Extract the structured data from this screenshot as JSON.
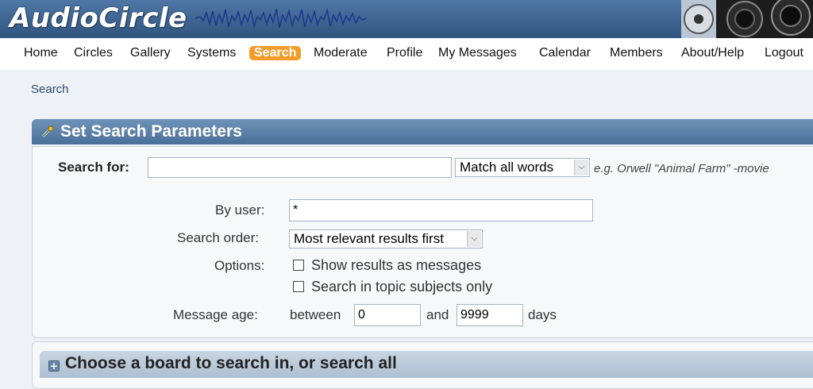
{
  "header": {
    "logo_text": "AudioCircle"
  },
  "nav": {
    "items": [
      "Home",
      "Circles",
      "Gallery",
      "Systems",
      "Search",
      "Moderate",
      "Profile",
      "My Messages",
      "Calendar",
      "Members",
      "About/Help",
      "Logout"
    ],
    "active": "Search"
  },
  "breadcrumb": "Search",
  "search_panel": {
    "title": "Set Search Parameters",
    "search_for_label": "Search for:",
    "search_for_value": "",
    "match_select": "Match all words",
    "example_hint": "e.g. Orwell \"Animal Farm\" -movie",
    "by_user_label": "By user:",
    "by_user_value": "*",
    "search_order_label": "Search order:",
    "search_order_value": "Most relevant results first",
    "options_label": "Options:",
    "option_messages": "Show results as messages",
    "option_subjects": "Search in topic subjects only",
    "message_age_label": "Message age:",
    "between_label": "between",
    "age_min": "0",
    "and_label": "and",
    "age_max": "9999",
    "days_label": "days"
  },
  "board_panel": {
    "title": "Choose a board to search in, or search all",
    "expand_icon": "plus-icon"
  },
  "colors": {
    "header_blue": "#3f6592",
    "active_tab": "#f39c2b",
    "panel_head": "#5d82ab"
  }
}
